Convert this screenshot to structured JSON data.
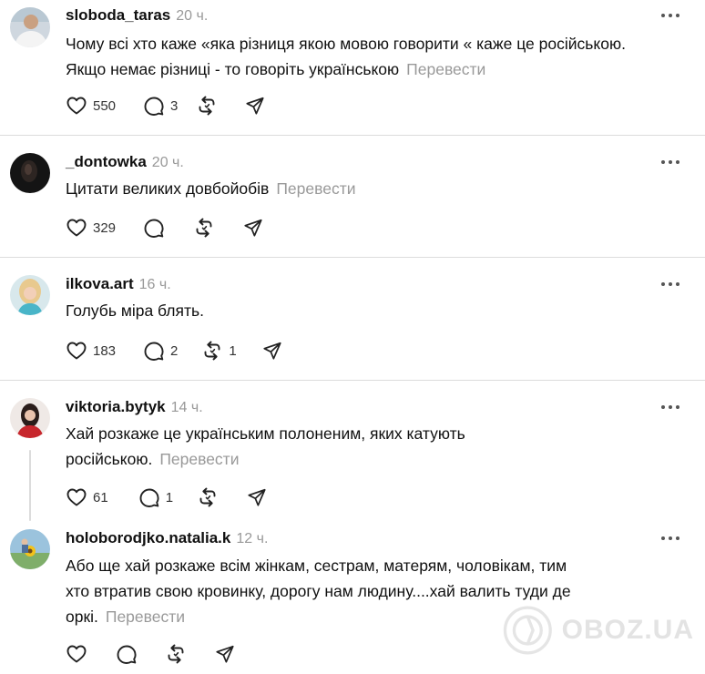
{
  "posts": [
    {
      "username": "sloboda_taras",
      "time": "20 ч.",
      "lines": [
        "Чому всі хто каже «яка різниця якою мовою говорити « каже це російською.",
        "Якщо немає різниці - то говоріть українською"
      ],
      "translate": "Перевести",
      "likes": "550",
      "replies": "3",
      "reposts": ""
    },
    {
      "username": "_dontowka",
      "time": "20 ч.",
      "lines": [
        "Цитати великих довбойобів"
      ],
      "translate": "Перевести",
      "likes": "329",
      "replies": "",
      "reposts": ""
    },
    {
      "username": "ilkova.art",
      "time": "16 ч.",
      "lines": [
        "Голубь міра блять."
      ],
      "translate": "",
      "likes": "183",
      "replies": "2",
      "reposts": "1"
    },
    {
      "username": "viktoria.bytyk",
      "time": "14 ч.",
      "lines": [
        "Хай розкаже це українським полоненим, яких катують",
        "російською."
      ],
      "translate": "Перевести",
      "likes": "61",
      "replies": "1",
      "reposts": ""
    },
    {
      "username": "holoborodjko.natalia.k",
      "time": "12 ч.",
      "lines": [
        "Або ще хай розкаже всім жінкам, сестрам, матерям, чоловікам, тим",
        "хто втратив свою кровинку, дорогу нам людину....хай валить туди де",
        "оркі."
      ],
      "translate": "Перевести",
      "likes": "",
      "replies": "",
      "reposts": ""
    }
  ],
  "watermark": "OBOZ.UA",
  "icons": [
    "heart-icon",
    "comment-icon",
    "repost-icon",
    "share-icon",
    "more-icon"
  ]
}
